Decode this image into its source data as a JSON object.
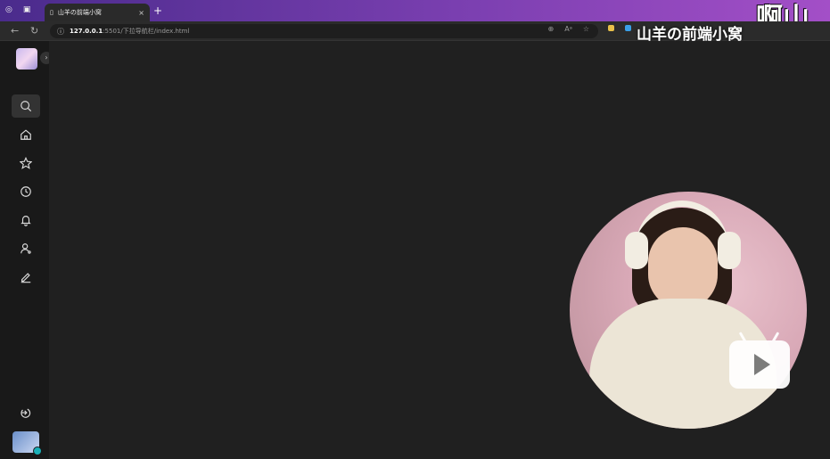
{
  "browser": {
    "tab_title": "山羊の前端小窝",
    "tab_close": "×",
    "new_tab": "+",
    "url_host": "127.0.0.1",
    "url_rest": ":5501/下拉导航栏/index.html"
  },
  "overlay": {
    "watermark": "山羊の前端小窝",
    "big_text": "啊山"
  },
  "sidebar": {
    "expand_glyph": "›",
    "items": [
      {
        "name": "search",
        "active": true
      },
      {
        "name": "home",
        "active": false
      },
      {
        "name": "favorites",
        "active": false
      },
      {
        "name": "history",
        "active": false
      },
      {
        "name": "notifications",
        "active": false
      },
      {
        "name": "profile",
        "active": false
      },
      {
        "name": "edit",
        "active": false
      },
      {
        "name": "logout",
        "active": false
      }
    ]
  },
  "colors": {
    "tabbar_start": "#4a2b8c",
    "tabbar_end": "#a34fc7",
    "sidebar_bg": "#191919",
    "main_bg": "#202020"
  }
}
